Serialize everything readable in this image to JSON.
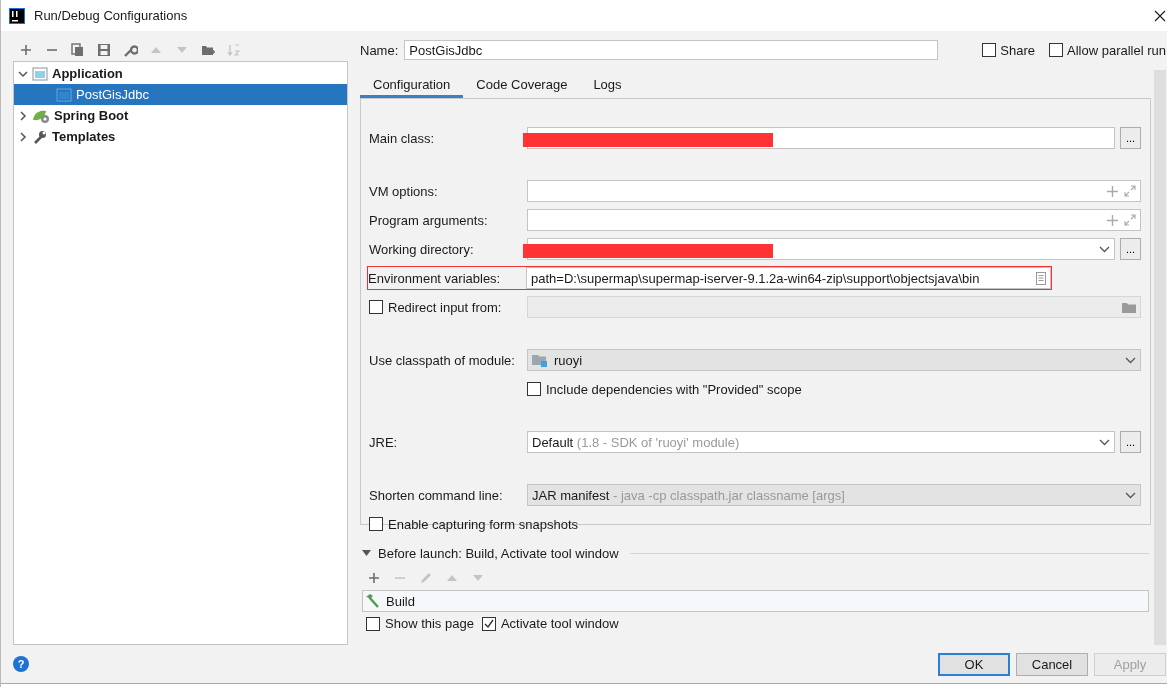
{
  "window": {
    "title": "Run/Debug Configurations"
  },
  "toolbar": [
    {
      "kind": "add",
      "disabled": false
    },
    {
      "kind": "remove",
      "disabled": false
    },
    {
      "kind": "copy",
      "disabled": false
    },
    {
      "kind": "save",
      "disabled": false
    },
    {
      "kind": "wrench",
      "disabled": false
    },
    {
      "kind": "up",
      "disabled": true
    },
    {
      "kind": "down",
      "disabled": true
    },
    {
      "kind": "folder",
      "disabled": false
    },
    {
      "kind": "sort",
      "disabled": true
    }
  ],
  "tree": [
    {
      "label": "Application",
      "kind": "application",
      "expanded": true,
      "selected": false,
      "children": [
        {
          "label": "PostGisJdbc",
          "kind": "config",
          "selected": true
        }
      ]
    },
    {
      "label": "Spring Boot",
      "kind": "spring",
      "expanded": false,
      "selected": false
    },
    {
      "label": "Templates",
      "kind": "templates",
      "expanded": false,
      "selected": false
    }
  ],
  "name": {
    "label": "Name:",
    "value": "PostGisJdbc"
  },
  "options": [
    {
      "label": "Share",
      "checked": false
    },
    {
      "label": "Allow parallel run",
      "checked": false
    }
  ],
  "tabs": [
    {
      "label": "Configuration",
      "selected": true
    },
    {
      "label": "Code Coverage",
      "selected": false
    },
    {
      "label": "Logs",
      "selected": false
    }
  ],
  "groups": [
    [
      {
        "kind": "text",
        "label": "Main class:",
        "redacted": true,
        "browse": "..."
      }
    ],
    [
      {
        "kind": "expandable",
        "label": "VM options:"
      },
      {
        "kind": "expandable",
        "label": "Program arguments:"
      },
      {
        "kind": "combo",
        "label": "Working directory:",
        "redacted": true,
        "browse": "..."
      },
      {
        "kind": "env",
        "label": "Environment variables:",
        "value": "path=D:\\supermap\\supermap-iserver-9.1.2a-win64-zip\\support\\objectsjava\\bin",
        "highlighted": true
      },
      {
        "kind": "checkfield",
        "label": "Redirect input from:",
        "checked": false
      }
    ],
    [
      {
        "kind": "module",
        "label": "Use classpath of module:",
        "value": "ruoyi"
      },
      {
        "kind": "checkbox",
        "label": "Include dependencies with \"Provided\" scope",
        "checked": false
      }
    ],
    [
      {
        "kind": "jre",
        "label": "JRE:",
        "value": "Default",
        "hint": "(1.8 - SDK of 'ruoyi' module)",
        "browse": "..."
      }
    ],
    [
      {
        "kind": "shorten",
        "label": "Shorten command line:",
        "value": "JAR manifest",
        "hint": "- java -cp classpath.jar classname [args]"
      },
      {
        "kind": "checkbox",
        "label": "Enable capturing form snapshots",
        "checked": false
      }
    ]
  ],
  "before_launch": {
    "title": "Before launch: Build, Activate tool window",
    "expanded": true,
    "toolbar": [
      {
        "kind": "add",
        "disabled": false
      },
      {
        "kind": "remove",
        "disabled": true
      },
      {
        "kind": "edit",
        "disabled": true
      },
      {
        "kind": "up",
        "disabled": true
      },
      {
        "kind": "down",
        "disabled": true
      }
    ],
    "tasks": [
      {
        "label": "Build"
      }
    ],
    "options": [
      {
        "label": "Show this page",
        "checked": false
      },
      {
        "label": "Activate tool window",
        "checked": true
      }
    ]
  },
  "help": "?",
  "buttons": [
    {
      "label": "OK",
      "default": true,
      "disabled": false
    },
    {
      "label": "Cancel",
      "default": false,
      "disabled": false
    },
    {
      "label": "Apply",
      "default": false,
      "disabled": true
    }
  ]
}
